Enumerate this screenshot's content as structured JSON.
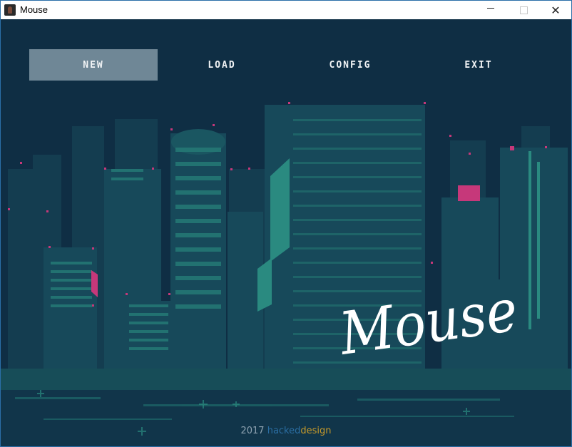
{
  "window": {
    "title": "Mouse",
    "controls": {
      "minimize": "minimize",
      "maximize": "maximize",
      "close": "close"
    }
  },
  "menu": {
    "items": [
      {
        "label": "NEW",
        "selected": true
      },
      {
        "label": "LOAD",
        "selected": false
      },
      {
        "label": "CONFIG",
        "selected": false
      },
      {
        "label": "EXIT",
        "selected": false
      }
    ]
  },
  "logo": {
    "text": "Mouse"
  },
  "footer": {
    "year": "2017",
    "hacked": "hacked",
    "design": "design"
  },
  "colors": {
    "background": "#0f2e44",
    "building": "#1b5a5f",
    "accent_teal": "#2a8a80",
    "accent_pink": "#c6387a",
    "menu_selected": "#6f8796",
    "footer_hacked": "#2b6ea3",
    "footer_design": "#c79a2a"
  },
  "icons": {
    "app": "mouse-app-icon"
  }
}
